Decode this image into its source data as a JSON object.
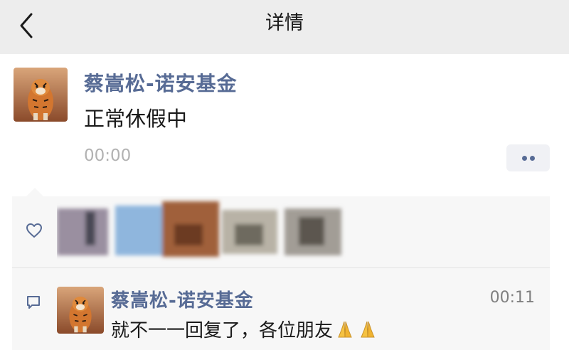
{
  "navbar": {
    "title": "详情"
  },
  "post": {
    "author": "蔡嵩松-诺安基金",
    "text": "正常休假中",
    "time": "00:00"
  },
  "comment": {
    "author": "蔡嵩松-诺安基金",
    "text": "就不一一回复了，各位朋友",
    "emoji": [
      "pray-icon",
      "pray-icon"
    ],
    "time": "00:11"
  },
  "colors": {
    "link": "#576b95",
    "navbar_bg": "#ededed",
    "comment_bg": "#f7f7f7"
  }
}
